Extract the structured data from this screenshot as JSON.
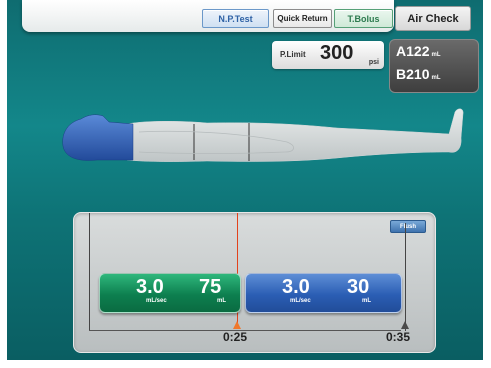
{
  "top_buttons": {
    "np_test": "N.P.Test",
    "quick_return": "Quick Return",
    "t_bolus": "T.Bolus"
  },
  "air_check": "Air Check",
  "pressure_limit": {
    "label": "P.Limit",
    "value": "300",
    "unit": "psi"
  },
  "syringes": [
    {
      "label": "A",
      "volume": "122",
      "unit": "mL"
    },
    {
      "label": "B",
      "volume": "210",
      "unit": "mL"
    }
  ],
  "timeline": {
    "flush_label": "Flush",
    "phases": [
      {
        "syringe": "A",
        "color": "#0d7f4f",
        "rate": "3.0",
        "rate_unit": "mL/sec",
        "volume": "75",
        "volume_unit": "mL"
      },
      {
        "syringe": "B",
        "color": "#2b5eb4",
        "rate": "3.0",
        "rate_unit": "mL/sec",
        "volume": "30",
        "volume_unit": "mL"
      }
    ],
    "time_markers": [
      "0:25",
      "0:35"
    ]
  },
  "colors": {
    "background": "#13878a",
    "head_highlight": "#2f5fb8",
    "cursor": "#e2421c"
  }
}
